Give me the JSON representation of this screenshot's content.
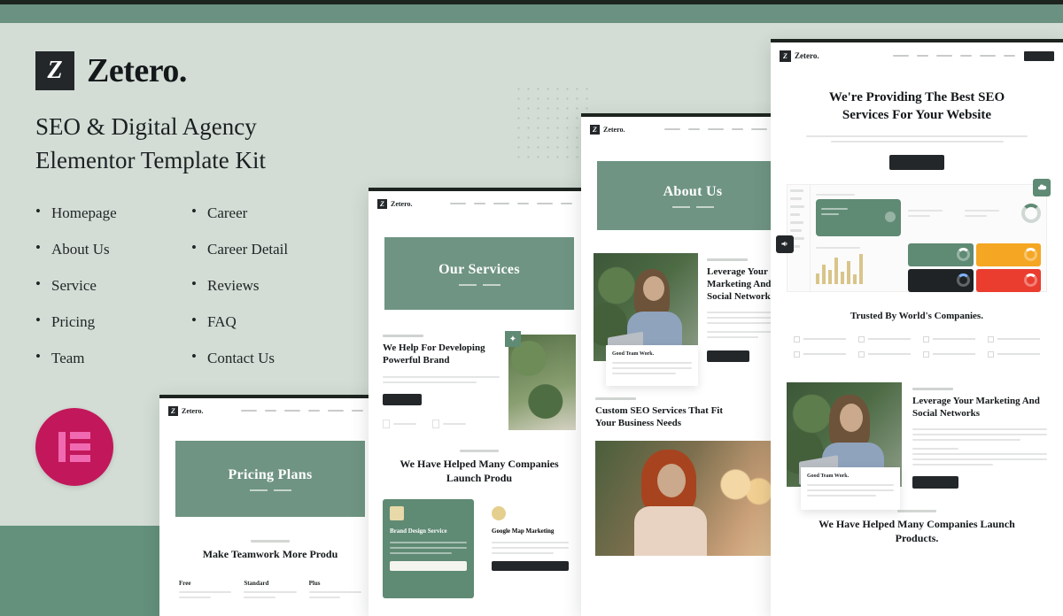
{
  "page": {
    "background_color": "#d3ddd5",
    "accent_green": "#6f9483",
    "dark": "#23272a",
    "elementor_pink": "#c2185b"
  },
  "left_panel": {
    "logo_letter": "Z",
    "brand_name": "Zetero.",
    "kit_title_line1": "SEO & Digital Agency",
    "kit_title_line2": "Elementor Template Kit",
    "features_column_1": [
      "Homepage",
      "About Us",
      "Service",
      "Pricing",
      "Team"
    ],
    "features_column_2": [
      "Career",
      "Career Detail",
      "Reviews",
      "FAQ",
      "Contact Us"
    ],
    "elementor_badge_name": "elementor-logo"
  },
  "mockups": {
    "pricing": {
      "name": "Pricing Plans",
      "logo_letter": "Z",
      "brand_name": "Zetero.",
      "hero_title": "Pricing Plans",
      "section_title": "Make Teamwork More Produ",
      "plans": [
        "Free",
        "Standard",
        "Plus"
      ]
    },
    "services": {
      "name": "Our Services",
      "logo_letter": "Z",
      "brand_name": "Zetero.",
      "hero_title": "Our Services",
      "block1_heading": "We Help For Developing Powerful Brand",
      "block2_heading": "We Have Helped Many Companies Launch Produ",
      "card1_title": "Brand Design Service",
      "card2_title": "Google Map Marketing"
    },
    "about": {
      "name": "About Us",
      "logo_letter": "Z",
      "brand_name": "Zetero.",
      "hero_title": "About Us",
      "block1_heading": "Leverage Your Marketing And Social Networks",
      "quote_card": "Good Team Work.",
      "block2_heading": "Custom SEO Services That Fit Your Business Needs"
    },
    "homepage": {
      "name": "Homepage",
      "logo_letter": "Z",
      "brand_name": "Zetero.",
      "hero_title": "We're Providing The Best SEO Services For Your Website",
      "trusted_title": "Trusted By World's Companies.",
      "leverage_heading": "Leverage Your Marketing And Social Networks",
      "quote_card": "Good Team Work.",
      "bottom_heading": "We Have Helped Many Companies Launch Products.",
      "dashboard": {
        "tile_colors": [
          "#5f8a74",
          "#f5a623",
          "#1f2326",
          "#ea3d2f"
        ],
        "bar_values": [
          12,
          22,
          16,
          30,
          14,
          26,
          11,
          34
        ]
      }
    }
  }
}
